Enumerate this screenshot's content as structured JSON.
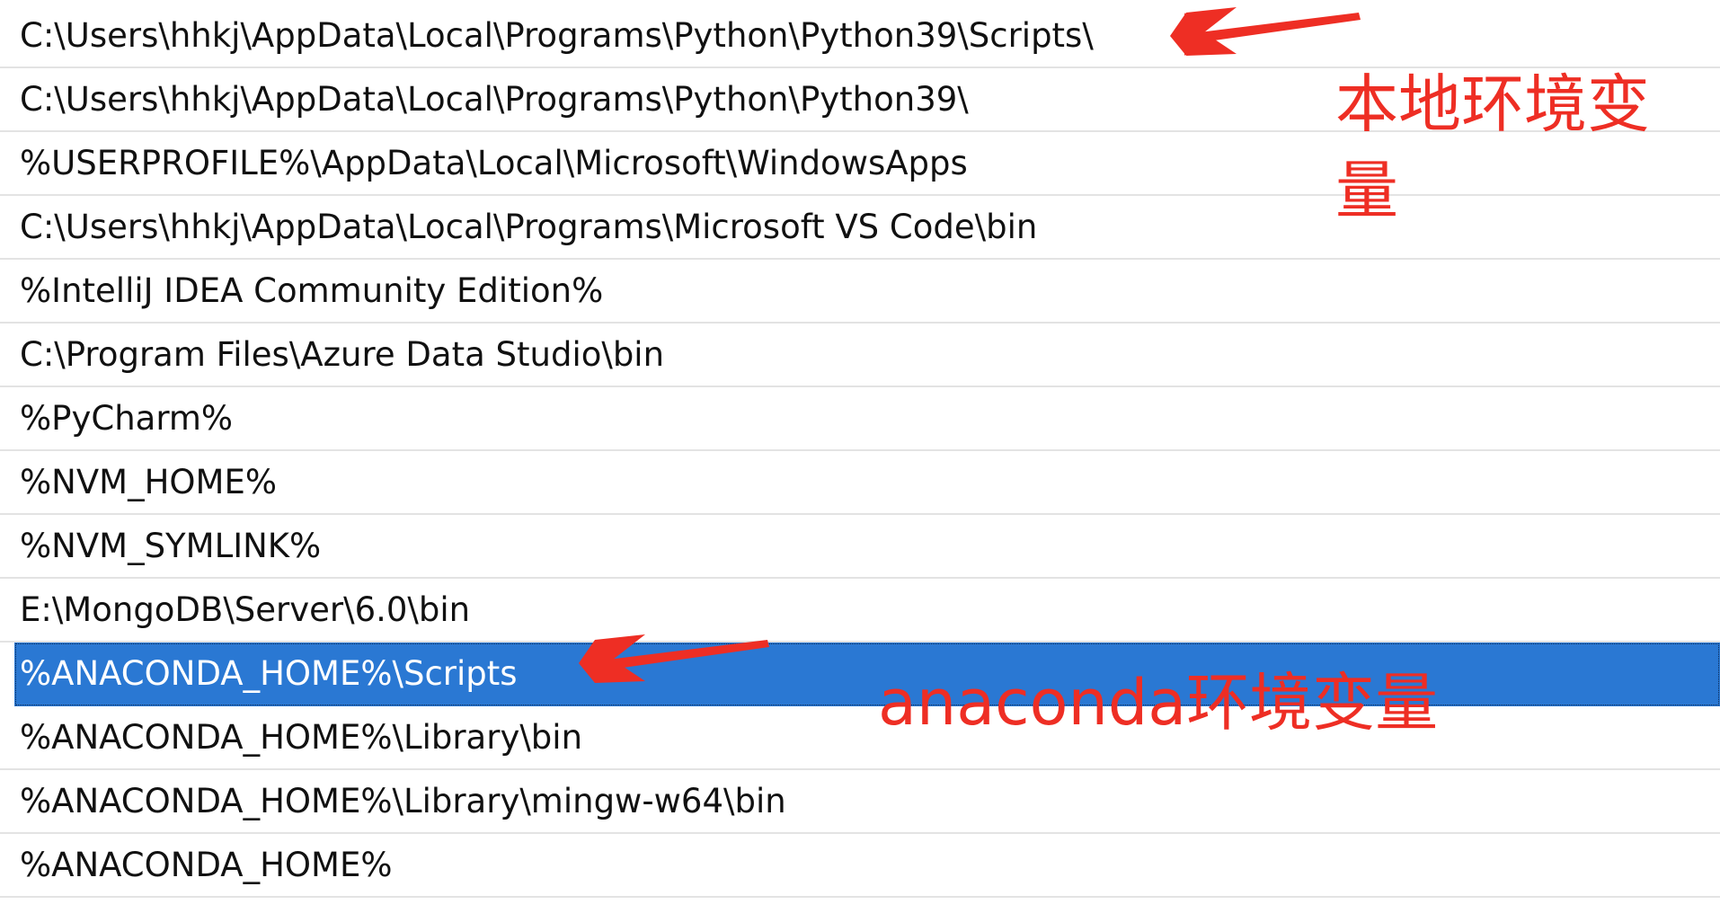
{
  "path_entries": [
    {
      "text": "C:\\Users\\hhkj\\AppData\\Local\\Programs\\Python\\Python39\\Scripts\\",
      "selected": false
    },
    {
      "text": "C:\\Users\\hhkj\\AppData\\Local\\Programs\\Python\\Python39\\",
      "selected": false
    },
    {
      "text": "%USERPROFILE%\\AppData\\Local\\Microsoft\\WindowsApps",
      "selected": false
    },
    {
      "text": "C:\\Users\\hhkj\\AppData\\Local\\Programs\\Microsoft VS Code\\bin",
      "selected": false
    },
    {
      "text": "%IntelliJ IDEA Community Edition%",
      "selected": false
    },
    {
      "text": "C:\\Program Files\\Azure Data Studio\\bin",
      "selected": false
    },
    {
      "text": "%PyCharm%",
      "selected": false
    },
    {
      "text": "%NVM_HOME%",
      "selected": false
    },
    {
      "text": "%NVM_SYMLINK%",
      "selected": false
    },
    {
      "text": "E:\\MongoDB\\Server\\6.0\\bin",
      "selected": false
    },
    {
      "text": "%ANACONDA_HOME%\\Scripts",
      "selected": true
    },
    {
      "text": "%ANACONDA_HOME%\\Library\\bin",
      "selected": false
    },
    {
      "text": "%ANACONDA_HOME%\\Library\\mingw-w64\\bin",
      "selected": false
    },
    {
      "text": "%ANACONDA_HOME%",
      "selected": false
    }
  ],
  "annotations": {
    "local_env": "本地环境变量",
    "anaconda_env": "anaconda环境变量"
  },
  "colors": {
    "annotation": "#ee2e24",
    "selection": "#2a78d3"
  }
}
